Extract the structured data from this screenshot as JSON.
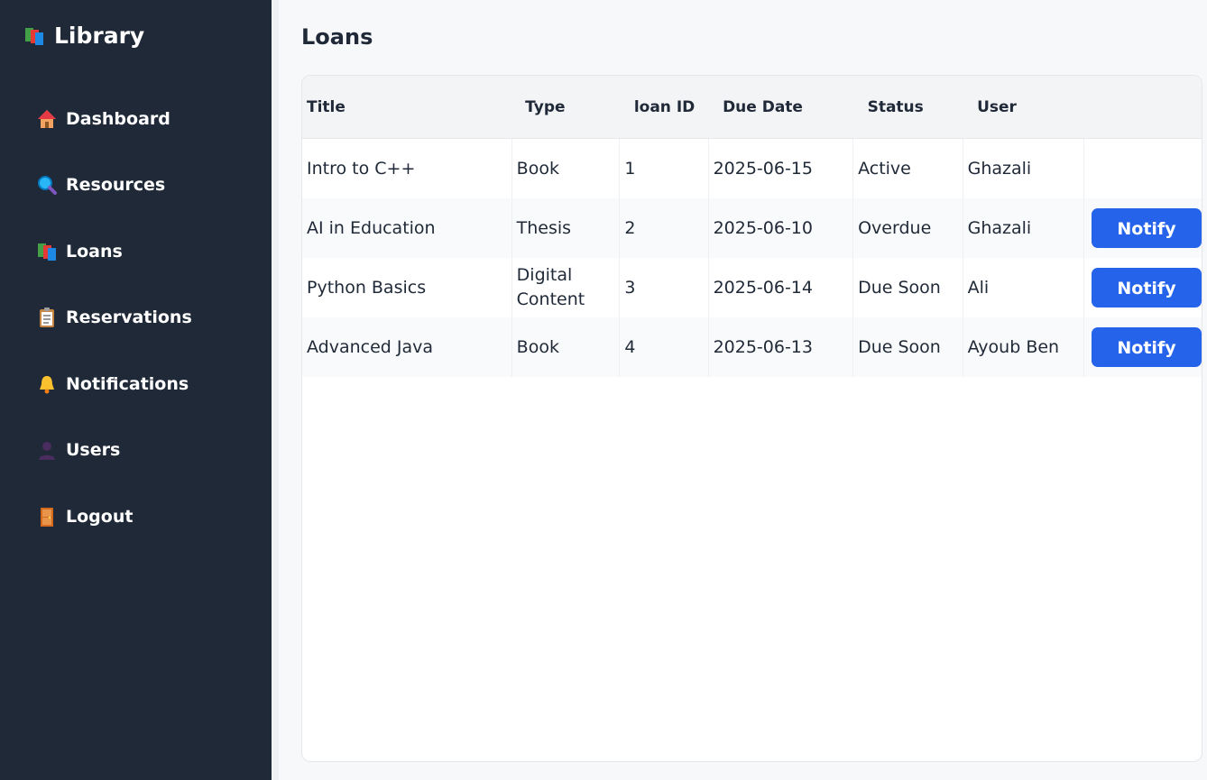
{
  "sidebar": {
    "brand": "Library",
    "items": [
      {
        "label": "Dashboard"
      },
      {
        "label": "Resources"
      },
      {
        "label": "Loans"
      },
      {
        "label": "Reservations"
      },
      {
        "label": "Notifications"
      },
      {
        "label": "Users"
      },
      {
        "label": "Logout"
      }
    ]
  },
  "page": {
    "title": "Loans"
  },
  "table": {
    "headers": [
      "Title",
      "Type",
      "loan ID",
      "Due Date",
      "Status",
      "User"
    ],
    "rows": [
      {
        "title": "Intro to C++",
        "type": "Book",
        "id": "1",
        "due": "2025-06-15",
        "status": "Active",
        "user": "Ghazali",
        "action": ""
      },
      {
        "title": "AI in Education",
        "type": "Thesis",
        "id": "2",
        "due": "2025-06-10",
        "status": "Overdue",
        "user": "Ghazali",
        "action": "Notify"
      },
      {
        "title": "Python Basics",
        "type": "Digital Content",
        "id": "3",
        "due": "2025-06-14",
        "status": "Due Soon",
        "user": "Ali",
        "action": "Notify"
      },
      {
        "title": "Advanced Java",
        "type": "Book",
        "id": "4",
        "due": "2025-06-13",
        "status": "Due Soon",
        "user": "Ayoub Ben",
        "action": "Notify"
      }
    ]
  },
  "colors": {
    "sidebar_bg": "#1f2937",
    "accent": "#2563eb"
  }
}
